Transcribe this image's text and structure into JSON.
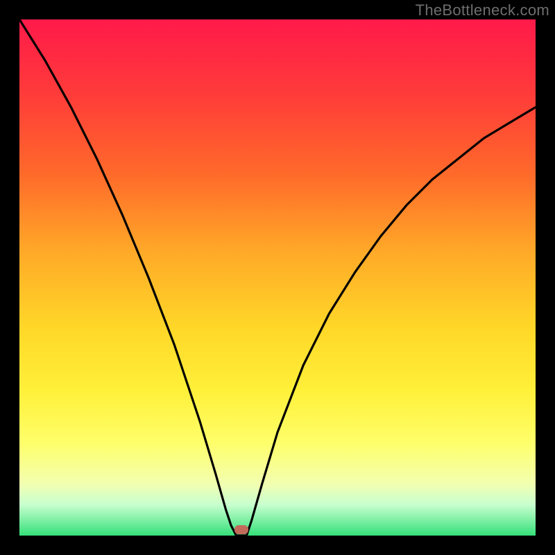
{
  "watermark": "TheBottleneck.com",
  "chart_data": {
    "type": "line",
    "title": "",
    "xlabel": "",
    "ylabel": "",
    "xlim": [
      0,
      100
    ],
    "ylim": [
      0,
      100
    ],
    "series": [
      {
        "name": "bottleneck-curve",
        "x": [
          0,
          5,
          10,
          15,
          20,
          25,
          30,
          35,
          38,
          40,
          41,
          42,
          43,
          44,
          45,
          47,
          50,
          55,
          60,
          65,
          70,
          75,
          80,
          85,
          90,
          95,
          100
        ],
        "values": [
          100,
          92,
          83,
          73,
          62,
          50,
          37,
          22,
          12,
          5,
          2,
          0,
          0,
          0,
          3,
          10,
          20,
          33,
          43,
          51,
          58,
          64,
          69,
          73,
          77,
          80,
          83
        ]
      }
    ],
    "marker": {
      "x": 43,
      "y": 0,
      "color": "#c26b5b"
    },
    "gradient_stops": [
      {
        "pct": 0,
        "color": "#ff1a4a"
      },
      {
        "pct": 14,
        "color": "#ff3a3a"
      },
      {
        "pct": 30,
        "color": "#ff6a2a"
      },
      {
        "pct": 45,
        "color": "#ffa928"
      },
      {
        "pct": 60,
        "color": "#ffd828"
      },
      {
        "pct": 72,
        "color": "#fff03a"
      },
      {
        "pct": 82,
        "color": "#ffff6a"
      },
      {
        "pct": 90,
        "color": "#f2ffb0"
      },
      {
        "pct": 94,
        "color": "#c8ffcf"
      },
      {
        "pct": 100,
        "color": "#34e07a"
      }
    ]
  }
}
